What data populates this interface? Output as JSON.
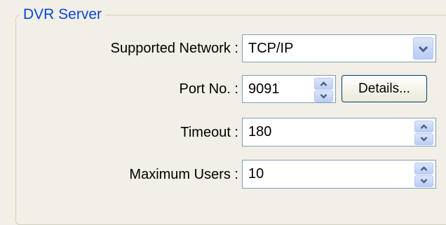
{
  "group": {
    "title": "DVR Server"
  },
  "network": {
    "label": "Supported Network :",
    "value": "TCP/IP"
  },
  "port": {
    "label": "Port No. :",
    "value": "9091",
    "details_label": "Details..."
  },
  "timeout": {
    "label": "Timeout :",
    "value": "180"
  },
  "max_users": {
    "label": "Maximum Users :",
    "value": "10"
  },
  "icons": {
    "dropdown": "chevron-down-icon",
    "spin_up": "arrow-up-icon",
    "spin_down": "arrow-down-icon"
  }
}
